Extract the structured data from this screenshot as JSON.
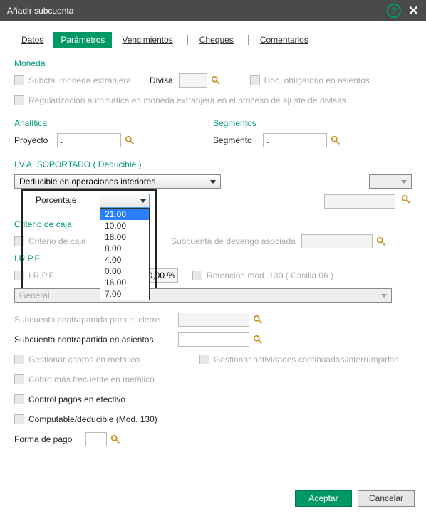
{
  "title": "Añadir subcuenta",
  "tabs": {
    "datos": "Datos",
    "parametros": "Parámetros",
    "vencimientos": "Vencimientos",
    "cheques": "Cheques",
    "comentarios": "Comentarios"
  },
  "moneda": {
    "group": "Moneda",
    "subcta_extranjera": "Subcta. moneda extranjera",
    "divisa": "Divisa",
    "doc_obligatorio": "Doc. obligatorio en asientos",
    "regularizacion": "Regularización automática en moneda extranjera en el proceso de ajuste de divisas"
  },
  "analitica": {
    "group": "Analítica",
    "proyecto": "Proyecto",
    "proyecto_value": "."
  },
  "segmentos": {
    "group": "Segmentos",
    "segmento": "Segmento",
    "segmento_value": "."
  },
  "iva": {
    "group": "I.V.A. SOPORTADO ( Deducible )",
    "deducible_value": "Deducible en operaciones interiores",
    "porcentaje": "Porcentaje",
    "options": [
      "21.00",
      "10.00",
      "18.00",
      "8.00",
      "4.00",
      "0.00",
      "16.00",
      "7.00"
    ]
  },
  "criterio": {
    "group": "Criterio de caja",
    "criterio_caja": "Criterio de caja",
    "subcuenta_devengo": "Subcuenta de devengo asociada"
  },
  "irpf": {
    "group": "I.R.P.F.",
    "irpf": "I.R.P.F.",
    "irpf_value": "0,00 %",
    "retencion": "Retención mod. 130 ( Casilla 06 )",
    "general_value": "General"
  },
  "cierre": {
    "sub_cierre": "Subcuenta contrapartida para el cierre",
    "sub_asientos": "Subcuenta contrapartida en asientos",
    "gestionar_cobros": "Gestionar cobros en metálico",
    "gestionar_actividades": "Gestionar actividades continuadas/interrumpidas",
    "cobro_frecuente": "Cobro más frecuente en metálico",
    "control_pagos": "Control pagos en efectivo",
    "computable": "Computable/deducible (Mod. 130)",
    "forma_pago": "Forma de pago"
  },
  "buttons": {
    "aceptar": "Aceptar",
    "cancelar": "Cancelar"
  }
}
